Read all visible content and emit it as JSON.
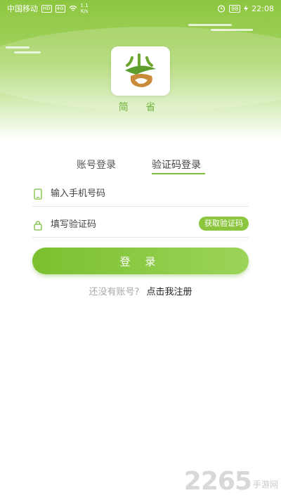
{
  "status_bar": {
    "carrier": "中国移动",
    "hd_badge": "HD",
    "signal_badge": "4G",
    "speed_top": "1.1",
    "speed_unit": "K/s",
    "battery": "98",
    "time": "22:08"
  },
  "app": {
    "name": "简 省",
    "brand_color": "#8cc63f"
  },
  "tabs": [
    {
      "label": "账号登录",
      "active": false
    },
    {
      "label": "验证码登录",
      "active": true
    }
  ],
  "form": {
    "phone_placeholder": "输入手机号码",
    "code_placeholder": "填写验证码",
    "get_code_label": "获取验证码",
    "login_label": "登 录"
  },
  "register": {
    "question": "还没有账号?",
    "link": "点击我注册"
  },
  "watermark": {
    "number": "2265",
    "suffix": "手游网"
  }
}
